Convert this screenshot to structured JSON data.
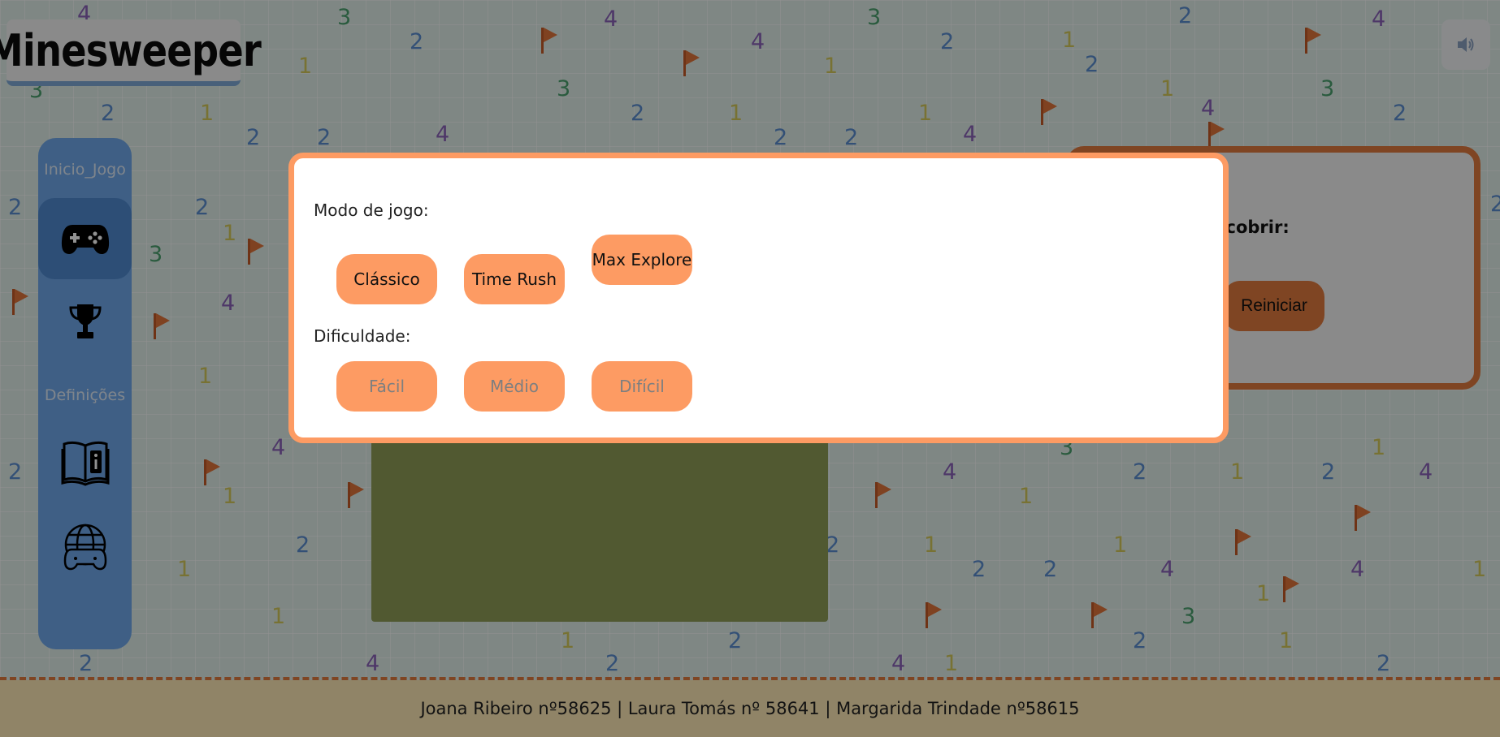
{
  "header": {
    "logo_text": "Minesweeper",
    "sound_icon": "speaker-icon"
  },
  "sidebar": {
    "label_start": "Inicio_Jogo",
    "label_settings": "Definições",
    "items": [
      {
        "name": "gamepad-icon"
      },
      {
        "name": "trophy-icon"
      },
      {
        "name": "book-info-icon"
      },
      {
        "name": "globe-gamepad-icon"
      }
    ]
  },
  "game_panel": {
    "partial_text": "scobrir:",
    "restart_label": "Reiniciar"
  },
  "modal": {
    "mode_label": "Modo de jogo:",
    "modes": [
      "Clássico",
      "Time Rush",
      "Max Explore"
    ],
    "difficulty_label": "Dificuldade:",
    "difficulties": [
      "Fácil",
      "Médio",
      "Difícil"
    ]
  },
  "footer": {
    "credits": "Joana Ribeiro nº58625 | Laura Tomás nº 58641 | Margarida Trindade nº58615"
  },
  "colors": {
    "accent": "#fd9b63",
    "accent_dark": "#e07a3e",
    "sidebar": "#6fa8ea",
    "footer_bg": "#fde9b6",
    "board": "#8f9d57"
  }
}
